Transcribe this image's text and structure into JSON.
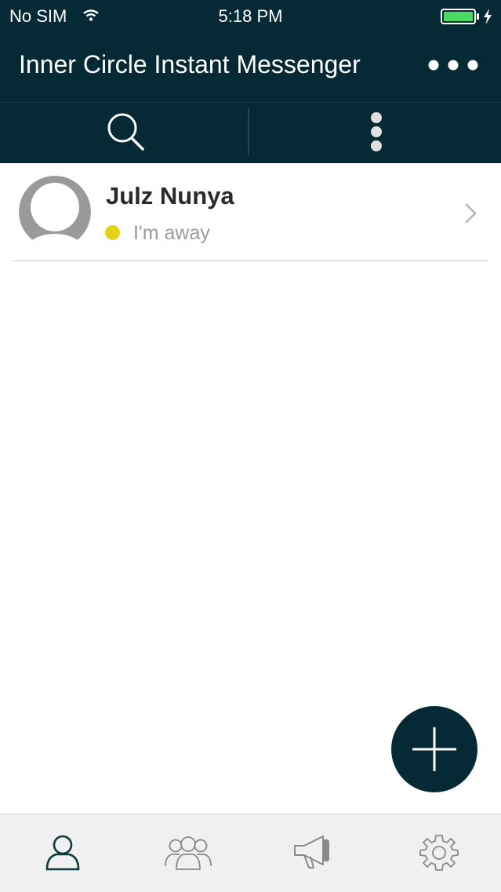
{
  "status_bar": {
    "carrier": "No SIM",
    "time": "5:18 PM"
  },
  "header": {
    "title": "Inner Circle Instant Messenger",
    "menu_icon": "more-horizontal-icon"
  },
  "toolbar": {
    "search_icon": "search-icon",
    "options_icon": "more-vertical-icon"
  },
  "contacts": [
    {
      "name": "Julz Nunya",
      "status": "I'm away",
      "status_color": "#e6d219"
    }
  ],
  "fab": {
    "icon": "plus-icon"
  },
  "tabs": [
    {
      "icon": "contact-icon",
      "active": true
    },
    {
      "icon": "groups-icon",
      "active": false
    },
    {
      "icon": "broadcast-icon",
      "active": false
    },
    {
      "icon": "settings-icon",
      "active": false
    }
  ],
  "colors": {
    "header_bg": "#062a35",
    "active_tab": "#0b3a40",
    "inactive_tab": "#8a8a8a",
    "away": "#e6d219"
  }
}
